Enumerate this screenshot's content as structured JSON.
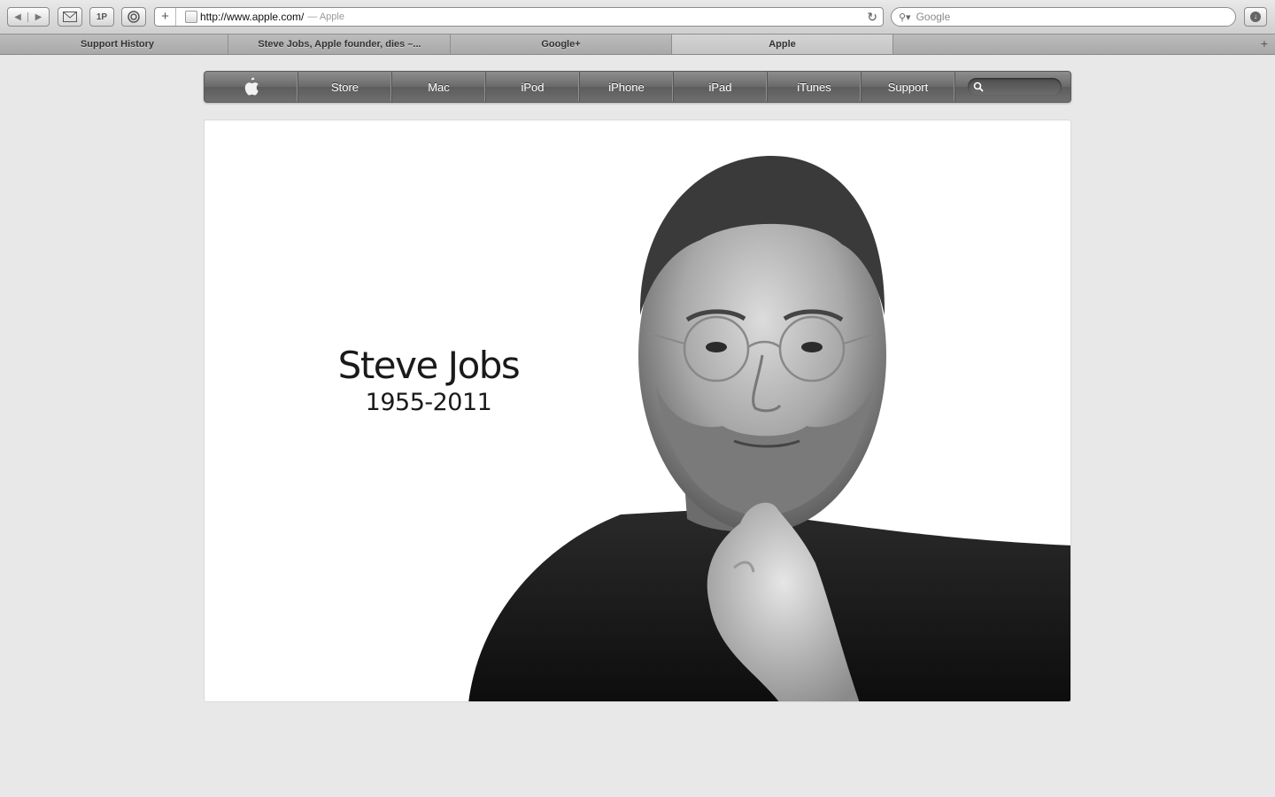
{
  "browser": {
    "toolbar": {
      "onep_label": "1P",
      "address": {
        "url": "http://www.apple.com/",
        "page_title": "— Apple"
      },
      "search_placeholder": "Google"
    },
    "tabs": [
      {
        "label": "Support History",
        "active": false
      },
      {
        "label": "Steve Jobs, Apple founder, dies –...",
        "active": false
      },
      {
        "label": "Google+",
        "active": false
      },
      {
        "label": "Apple",
        "active": true
      }
    ]
  },
  "site_nav": {
    "logo_icon": "apple-logo-icon",
    "items": [
      {
        "label": "Store"
      },
      {
        "label": "Mac"
      },
      {
        "label": "iPod"
      },
      {
        "label": "iPhone"
      },
      {
        "label": "iPad"
      },
      {
        "label": "iTunes"
      },
      {
        "label": "Support"
      }
    ]
  },
  "hero": {
    "name": "Steve Jobs",
    "years": "1955-2011",
    "image": "black-and-white-portrait"
  },
  "colors": {
    "page_background": "#e8e8e8",
    "nav_bar": "#6f6f6f",
    "hero_background": "#ffffff"
  }
}
